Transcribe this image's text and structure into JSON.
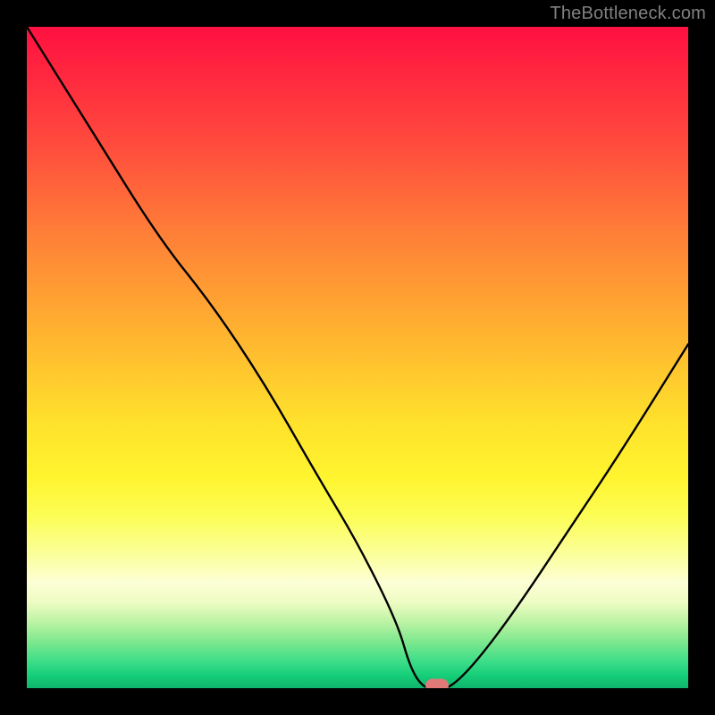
{
  "watermark": "TheBottleneck.com",
  "chart_data": {
    "type": "line",
    "title": "",
    "xlabel": "",
    "ylabel": "",
    "xlim": [
      0,
      100
    ],
    "ylim": [
      0,
      100
    ],
    "x": [
      0,
      10,
      20,
      28,
      36,
      44,
      50,
      56,
      58,
      60,
      62,
      64,
      68,
      74,
      82,
      90,
      100
    ],
    "y_percent": [
      100,
      84,
      68,
      58,
      46,
      32,
      22,
      10,
      3,
      0,
      0,
      0,
      4,
      12,
      24,
      36,
      52
    ],
    "marker": {
      "x_percent": 62,
      "y_percent": 0
    },
    "gradient_stops": [
      {
        "pos": 0,
        "color": "#ff1040"
      },
      {
        "pos": 50,
        "color": "#ffc72e"
      },
      {
        "pos": 80,
        "color": "#fbff9e"
      },
      {
        "pos": 100,
        "color": "#0fb56c"
      }
    ]
  }
}
